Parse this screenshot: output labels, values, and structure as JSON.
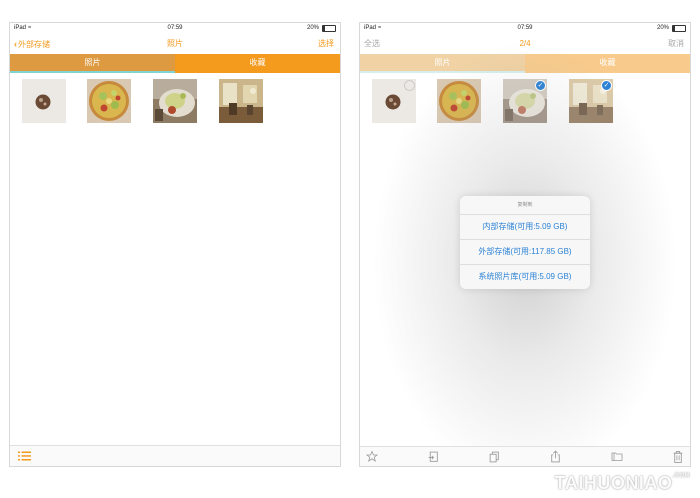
{
  "status_bar": {
    "carrier": "iPad",
    "time": "07:59",
    "battery_text": "20%",
    "battery_level": 0.2
  },
  "left_screen": {
    "nav": {
      "back_label": "外部存储",
      "title": "照片",
      "action_label": "选择"
    },
    "segment": {
      "photos_label": "照片",
      "favorites_label": "收藏"
    },
    "thumbnails": [
      {
        "name": "thumb-ball",
        "selected": false
      },
      {
        "name": "thumb-pizza",
        "selected": false
      },
      {
        "name": "thumb-food",
        "selected": false
      },
      {
        "name": "thumb-room",
        "selected": false
      }
    ]
  },
  "right_screen": {
    "nav": {
      "left_label": "全选",
      "title": "2/4",
      "right_label": "取消"
    },
    "segment": {
      "photos_label": "照片",
      "favorites_label": "收藏"
    },
    "thumbnails": [
      {
        "name": "thumb-ball",
        "selected": false
      },
      {
        "name": "thumb-pizza",
        "selected": false
      },
      {
        "name": "thumb-food",
        "selected": true
      },
      {
        "name": "thumb-room",
        "selected": true
      }
    ],
    "copy_sheet": {
      "title": "复制到",
      "options": [
        "内部存储(可用:5.09 GB)",
        "外部存储(可用:117.85 GB)",
        "系统照片库(可用:5.09 GB)"
      ]
    }
  },
  "watermark": {
    "text": "TAIHUONIAO",
    "suffix": ".COM"
  },
  "colors": {
    "accent": "#f39a1e",
    "segment_active": "#de9a40",
    "link_blue": "#2b82d6"
  },
  "icons": [
    "chevron-left-icon",
    "wifi-icon",
    "battery-icon",
    "list-icon",
    "star-icon",
    "import-icon",
    "copy-icon",
    "share-icon",
    "folder-icon",
    "trash-icon",
    "checkmark-icon"
  ]
}
